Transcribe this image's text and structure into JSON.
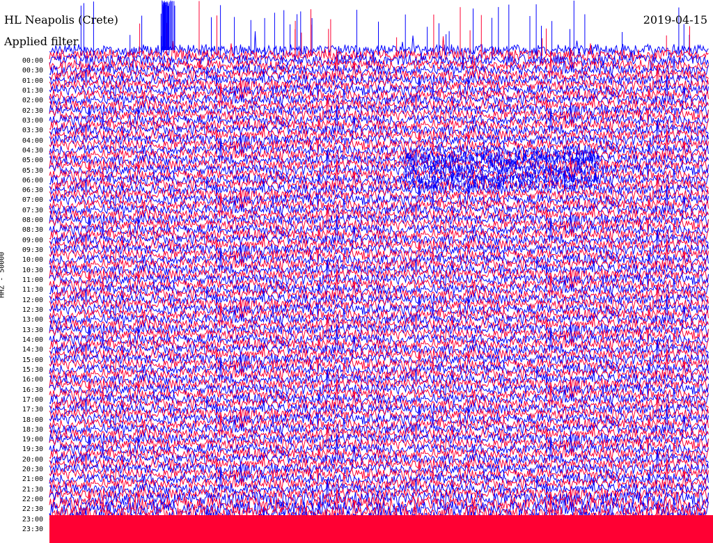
{
  "header": {
    "station": "HL Neapolis (Crete)",
    "date": "2019-04-15",
    "filter_note": "Applied filter",
    "channel": "HHZ - 50000"
  },
  "colors": {
    "trace_a": "#0000ff",
    "trace_b": "#ff0033",
    "background": "#ffffff"
  },
  "chart_data": {
    "type": "line",
    "title": "HL Neapolis (Crete)",
    "ylabel": "HHZ - 50000",
    "x_range_minutes": [
      0,
      15
    ],
    "row_interval_minutes": 15,
    "trace_colors_alternating": [
      "#0000ff",
      "#ff0033"
    ],
    "hour_labels": [
      "00:00",
      "00:30",
      "01:00",
      "01:30",
      "02:00",
      "02:30",
      "03:00",
      "03:30",
      "04:00",
      "04:30",
      "05:00",
      "05:30",
      "06:00",
      "06:30",
      "07:00",
      "07:30",
      "08:00",
      "08:30",
      "09:00",
      "09:30",
      "10:00",
      "10:30",
      "11:00",
      "11:30",
      "12:00",
      "12:30",
      "13:00",
      "13:30",
      "14:00",
      "14:30",
      "15:00",
      "15:30",
      "16:00",
      "16:30",
      "17:00",
      "17:30",
      "18:00",
      "18:30",
      "19:00",
      "19:30",
      "20:00",
      "20:30",
      "21:00",
      "21:30",
      "22:00",
      "22:30",
      "23:00",
      "23:30"
    ],
    "grid": false,
    "legend": "none"
  }
}
